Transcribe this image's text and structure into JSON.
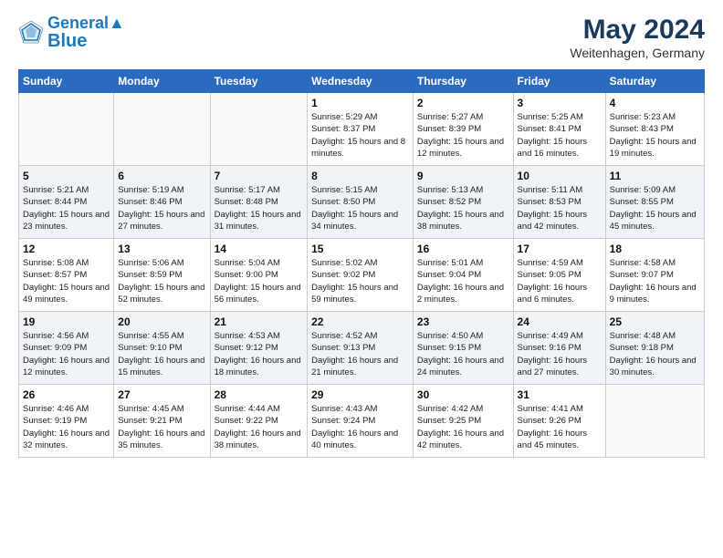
{
  "header": {
    "logo_line1": "General",
    "logo_line2": "Blue",
    "title": "May 2024",
    "subtitle": "Weitenhagen, Germany"
  },
  "days_of_week": [
    "Sunday",
    "Monday",
    "Tuesday",
    "Wednesday",
    "Thursday",
    "Friday",
    "Saturday"
  ],
  "weeks": [
    [
      {
        "day": "",
        "sunrise": "",
        "sunset": "",
        "daylight": ""
      },
      {
        "day": "",
        "sunrise": "",
        "sunset": "",
        "daylight": ""
      },
      {
        "day": "",
        "sunrise": "",
        "sunset": "",
        "daylight": ""
      },
      {
        "day": "1",
        "sunrise": "Sunrise: 5:29 AM",
        "sunset": "Sunset: 8:37 PM",
        "daylight": "Daylight: 15 hours and 8 minutes."
      },
      {
        "day": "2",
        "sunrise": "Sunrise: 5:27 AM",
        "sunset": "Sunset: 8:39 PM",
        "daylight": "Daylight: 15 hours and 12 minutes."
      },
      {
        "day": "3",
        "sunrise": "Sunrise: 5:25 AM",
        "sunset": "Sunset: 8:41 PM",
        "daylight": "Daylight: 15 hours and 16 minutes."
      },
      {
        "day": "4",
        "sunrise": "Sunrise: 5:23 AM",
        "sunset": "Sunset: 8:43 PM",
        "daylight": "Daylight: 15 hours and 19 minutes."
      }
    ],
    [
      {
        "day": "5",
        "sunrise": "Sunrise: 5:21 AM",
        "sunset": "Sunset: 8:44 PM",
        "daylight": "Daylight: 15 hours and 23 minutes."
      },
      {
        "day": "6",
        "sunrise": "Sunrise: 5:19 AM",
        "sunset": "Sunset: 8:46 PM",
        "daylight": "Daylight: 15 hours and 27 minutes."
      },
      {
        "day": "7",
        "sunrise": "Sunrise: 5:17 AM",
        "sunset": "Sunset: 8:48 PM",
        "daylight": "Daylight: 15 hours and 31 minutes."
      },
      {
        "day": "8",
        "sunrise": "Sunrise: 5:15 AM",
        "sunset": "Sunset: 8:50 PM",
        "daylight": "Daylight: 15 hours and 34 minutes."
      },
      {
        "day": "9",
        "sunrise": "Sunrise: 5:13 AM",
        "sunset": "Sunset: 8:52 PM",
        "daylight": "Daylight: 15 hours and 38 minutes."
      },
      {
        "day": "10",
        "sunrise": "Sunrise: 5:11 AM",
        "sunset": "Sunset: 8:53 PM",
        "daylight": "Daylight: 15 hours and 42 minutes."
      },
      {
        "day": "11",
        "sunrise": "Sunrise: 5:09 AM",
        "sunset": "Sunset: 8:55 PM",
        "daylight": "Daylight: 15 hours and 45 minutes."
      }
    ],
    [
      {
        "day": "12",
        "sunrise": "Sunrise: 5:08 AM",
        "sunset": "Sunset: 8:57 PM",
        "daylight": "Daylight: 15 hours and 49 minutes."
      },
      {
        "day": "13",
        "sunrise": "Sunrise: 5:06 AM",
        "sunset": "Sunset: 8:59 PM",
        "daylight": "Daylight: 15 hours and 52 minutes."
      },
      {
        "day": "14",
        "sunrise": "Sunrise: 5:04 AM",
        "sunset": "Sunset: 9:00 PM",
        "daylight": "Daylight: 15 hours and 56 minutes."
      },
      {
        "day": "15",
        "sunrise": "Sunrise: 5:02 AM",
        "sunset": "Sunset: 9:02 PM",
        "daylight": "Daylight: 15 hours and 59 minutes."
      },
      {
        "day": "16",
        "sunrise": "Sunrise: 5:01 AM",
        "sunset": "Sunset: 9:04 PM",
        "daylight": "Daylight: 16 hours and 2 minutes."
      },
      {
        "day": "17",
        "sunrise": "Sunrise: 4:59 AM",
        "sunset": "Sunset: 9:05 PM",
        "daylight": "Daylight: 16 hours and 6 minutes."
      },
      {
        "day": "18",
        "sunrise": "Sunrise: 4:58 AM",
        "sunset": "Sunset: 9:07 PM",
        "daylight": "Daylight: 16 hours and 9 minutes."
      }
    ],
    [
      {
        "day": "19",
        "sunrise": "Sunrise: 4:56 AM",
        "sunset": "Sunset: 9:09 PM",
        "daylight": "Daylight: 16 hours and 12 minutes."
      },
      {
        "day": "20",
        "sunrise": "Sunrise: 4:55 AM",
        "sunset": "Sunset: 9:10 PM",
        "daylight": "Daylight: 16 hours and 15 minutes."
      },
      {
        "day": "21",
        "sunrise": "Sunrise: 4:53 AM",
        "sunset": "Sunset: 9:12 PM",
        "daylight": "Daylight: 16 hours and 18 minutes."
      },
      {
        "day": "22",
        "sunrise": "Sunrise: 4:52 AM",
        "sunset": "Sunset: 9:13 PM",
        "daylight": "Daylight: 16 hours and 21 minutes."
      },
      {
        "day": "23",
        "sunrise": "Sunrise: 4:50 AM",
        "sunset": "Sunset: 9:15 PM",
        "daylight": "Daylight: 16 hours and 24 minutes."
      },
      {
        "day": "24",
        "sunrise": "Sunrise: 4:49 AM",
        "sunset": "Sunset: 9:16 PM",
        "daylight": "Daylight: 16 hours and 27 minutes."
      },
      {
        "day": "25",
        "sunrise": "Sunrise: 4:48 AM",
        "sunset": "Sunset: 9:18 PM",
        "daylight": "Daylight: 16 hours and 30 minutes."
      }
    ],
    [
      {
        "day": "26",
        "sunrise": "Sunrise: 4:46 AM",
        "sunset": "Sunset: 9:19 PM",
        "daylight": "Daylight: 16 hours and 32 minutes."
      },
      {
        "day": "27",
        "sunrise": "Sunrise: 4:45 AM",
        "sunset": "Sunset: 9:21 PM",
        "daylight": "Daylight: 16 hours and 35 minutes."
      },
      {
        "day": "28",
        "sunrise": "Sunrise: 4:44 AM",
        "sunset": "Sunset: 9:22 PM",
        "daylight": "Daylight: 16 hours and 38 minutes."
      },
      {
        "day": "29",
        "sunrise": "Sunrise: 4:43 AM",
        "sunset": "Sunset: 9:24 PM",
        "daylight": "Daylight: 16 hours and 40 minutes."
      },
      {
        "day": "30",
        "sunrise": "Sunrise: 4:42 AM",
        "sunset": "Sunset: 9:25 PM",
        "daylight": "Daylight: 16 hours and 42 minutes."
      },
      {
        "day": "31",
        "sunrise": "Sunrise: 4:41 AM",
        "sunset": "Sunset: 9:26 PM",
        "daylight": "Daylight: 16 hours and 45 minutes."
      },
      {
        "day": "",
        "sunrise": "",
        "sunset": "",
        "daylight": ""
      }
    ]
  ]
}
